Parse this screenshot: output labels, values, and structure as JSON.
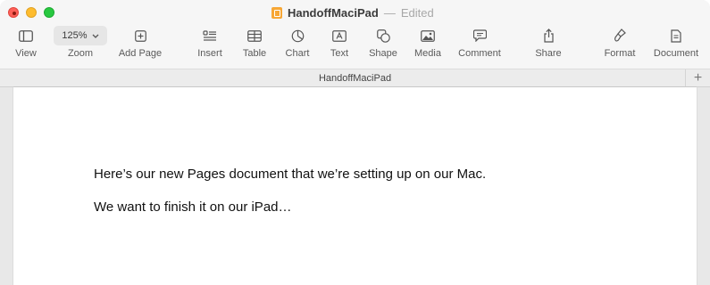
{
  "window": {
    "title": "HandoffMaciPad",
    "separator": "—",
    "status": "Edited"
  },
  "toolbar": {
    "view": {
      "label": "View",
      "icon": "sidebar-icon"
    },
    "zoom": {
      "label": "Zoom",
      "value": "125%",
      "icon": "chevron-down-icon"
    },
    "add_page": {
      "label": "Add Page",
      "icon": "plus-square-icon"
    },
    "insert": {
      "label": "Insert",
      "icon": "insert-icon"
    },
    "table": {
      "label": "Table",
      "icon": "table-icon"
    },
    "chart": {
      "label": "Chart",
      "icon": "chart-icon"
    },
    "text": {
      "label": "Text",
      "icon": "text-box-icon"
    },
    "shape": {
      "label": "Shape",
      "icon": "shape-icon"
    },
    "media": {
      "label": "Media",
      "icon": "media-icon"
    },
    "comment": {
      "label": "Comment",
      "icon": "comment-icon"
    },
    "share": {
      "label": "Share",
      "icon": "share-icon"
    },
    "format": {
      "label": "Format",
      "icon": "paintbrush-icon"
    },
    "document": {
      "label": "Document",
      "icon": "document-icon"
    }
  },
  "tabbar": {
    "tab_title": "HandoffMaciPad",
    "add_label": "+"
  },
  "document": {
    "paragraphs": [
      "Here’s our new Pages document that we’re setting up on our Mac.",
      "We want to finish it on our iPad…"
    ]
  },
  "colors": {
    "close": "#fe5f57",
    "minimize": "#febc2e",
    "zoom": "#28c840",
    "doc_icon": "#f7a735"
  }
}
